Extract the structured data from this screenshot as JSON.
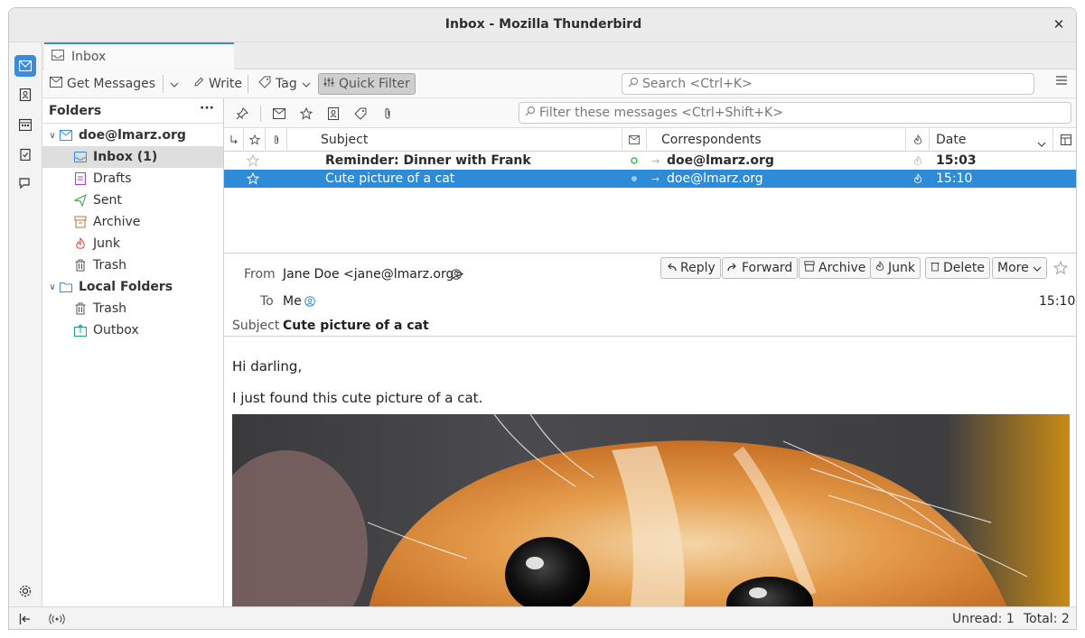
{
  "window": {
    "title": "Inbox - Mozilla Thunderbird",
    "close": "✕"
  },
  "tab": {
    "label": "Inbox"
  },
  "toolbar": {
    "get_messages": "Get Messages",
    "write": "Write",
    "tag": "Tag",
    "quick_filter": "Quick Filter",
    "search_placeholder": "Search <Ctrl+K>"
  },
  "folders": {
    "header": "Folders",
    "more": "···",
    "account": "doe@lmarz.org",
    "items": [
      {
        "label": "Inbox (1)"
      },
      {
        "label": "Drafts"
      },
      {
        "label": "Sent"
      },
      {
        "label": "Archive"
      },
      {
        "label": "Junk"
      },
      {
        "label": "Trash"
      }
    ],
    "local": "Local Folders",
    "local_items": [
      {
        "label": "Trash"
      },
      {
        "label": "Outbox"
      }
    ]
  },
  "quickfilter": {
    "placeholder": "Filter these messages <Ctrl+Shift+K>"
  },
  "columns": {
    "subject": "Subject",
    "correspondents": "Correspondents",
    "date": "Date"
  },
  "messages": [
    {
      "subject": "Reminder: Dinner with Frank",
      "from": "doe@lmarz.org",
      "date": "15:03",
      "unread": true
    },
    {
      "subject": "Cute picture of a cat",
      "from": "doe@lmarz.org",
      "date": "15:10",
      "unread": false
    }
  ],
  "header": {
    "from_label": "From",
    "from_value": "Jane Doe <jane@lmarz.org>",
    "to_label": "To",
    "to_value": "Me",
    "subject_label": "Subject",
    "subject_value": "Cute picture of a cat",
    "time": "15:10",
    "buttons": {
      "reply": "Reply",
      "forward": "Forward",
      "archive": "Archive",
      "junk": "Junk",
      "delete": "Delete",
      "more": "More"
    }
  },
  "body": {
    "line1": "Hi darling,",
    "line2": "I just found this cute picture of a cat."
  },
  "status": {
    "unread": "Unread: 1",
    "total": "Total: 2"
  },
  "colors": {
    "accent": "#3b8ddc",
    "selection": "#2e8bd8",
    "unread_dot": "#3fb950"
  }
}
